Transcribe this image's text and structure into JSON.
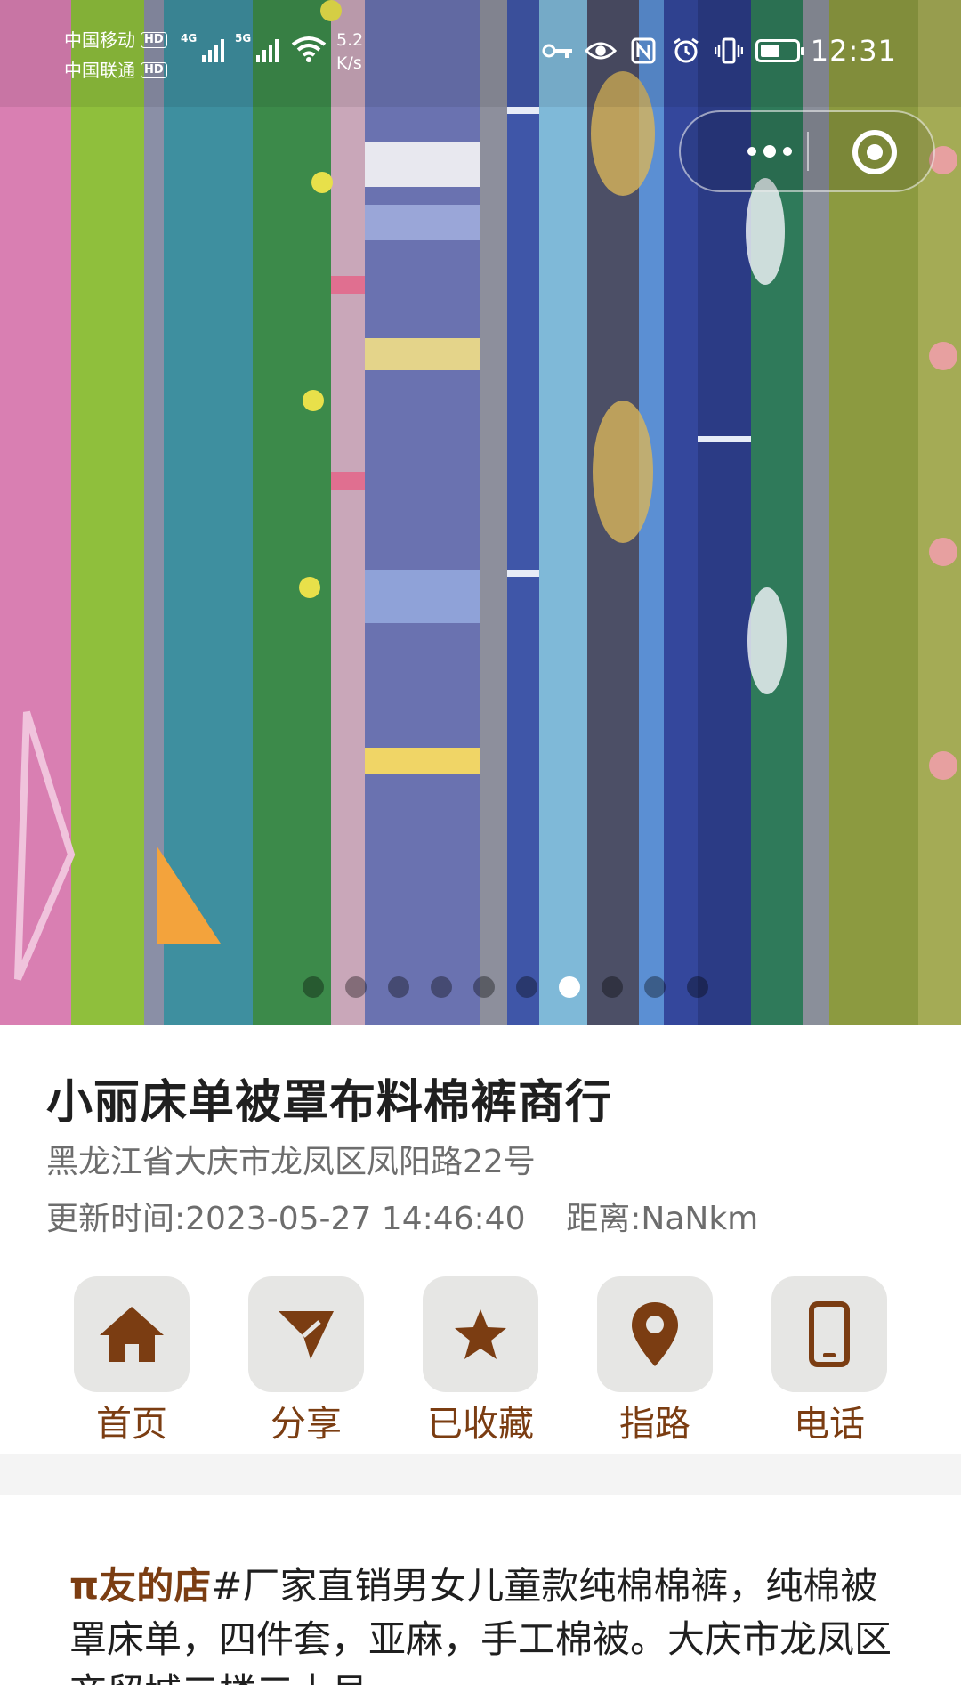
{
  "status_bar": {
    "carrier_1": "中国移动",
    "carrier_2": "中国联通",
    "hd_badge": "HD",
    "network_1": "4G",
    "network_2": "5G",
    "speed_value": "5.2",
    "speed_unit": "K/s",
    "time": "12:31",
    "battery_level": 0.55
  },
  "banner": {
    "slide_count": 10,
    "active_slide_index": 6
  },
  "shop": {
    "name": "小丽床单被罩布料棉裤商行",
    "address": "黑龙江省大庆市龙凤区凤阳路22号",
    "updated": "更新时间:2023-05-27 14:46:40",
    "distance": "距离:NaNkm"
  },
  "actions": [
    {
      "label": "首页",
      "icon": "home-icon"
    },
    {
      "label": "分享",
      "icon": "share-icon"
    },
    {
      "label": "已收藏",
      "icon": "star-icon"
    },
    {
      "label": "指路",
      "icon": "location-pin-icon"
    },
    {
      "label": "电话",
      "icon": "phone-icon"
    }
  ],
  "description": {
    "tag": "π友的店",
    "text": "#厂家直销男女儿童款纯棉棉裤，纯棉被罩床单，四件套，亚麻，手工棉被。大庆市龙凤区商贸城三楼三十号"
  },
  "colors": {
    "accent": "#7b3d12",
    "tile_bg": "#e6e6e4",
    "divider_bg": "#f4f4f4"
  }
}
